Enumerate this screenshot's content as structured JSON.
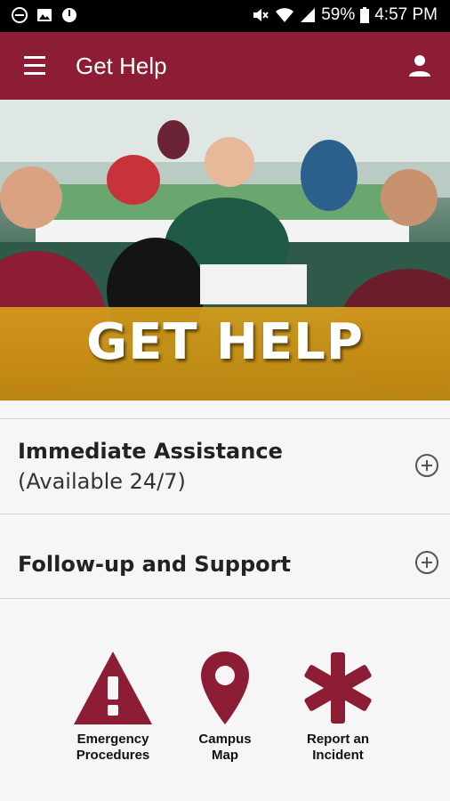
{
  "status_bar": {
    "battery": "59%",
    "time": "4:57 PM",
    "icons": [
      "do-not-disturb-icon",
      "image-icon",
      "clock-icon",
      "mute-icon",
      "wifi-icon",
      "signal-icon",
      "battery-icon"
    ]
  },
  "app_bar": {
    "title": "Get Help",
    "menu_icon": "hamburger-menu-icon",
    "account_icon": "person-icon"
  },
  "hero": {
    "title": "GET HELP"
  },
  "accordion": {
    "items": [
      {
        "label": "Immediate Assistance",
        "sublabel": "(Available 24/7)",
        "icon": "plus-circle-icon"
      },
      {
        "label": "Follow-up and Support",
        "icon": "plus-circle-icon"
      }
    ]
  },
  "quick_links": [
    {
      "label": "Emergency\nProcedures",
      "icon": "warning-triangle-icon"
    },
    {
      "label": "Campus\nMap",
      "icon": "map-pin-icon"
    },
    {
      "label": "Report an\nIncident",
      "icon": "asterisk-icon"
    }
  ],
  "colors": {
    "brand": "#8c1d35",
    "band": "#d69e1c",
    "background": "#f6f6f6"
  }
}
